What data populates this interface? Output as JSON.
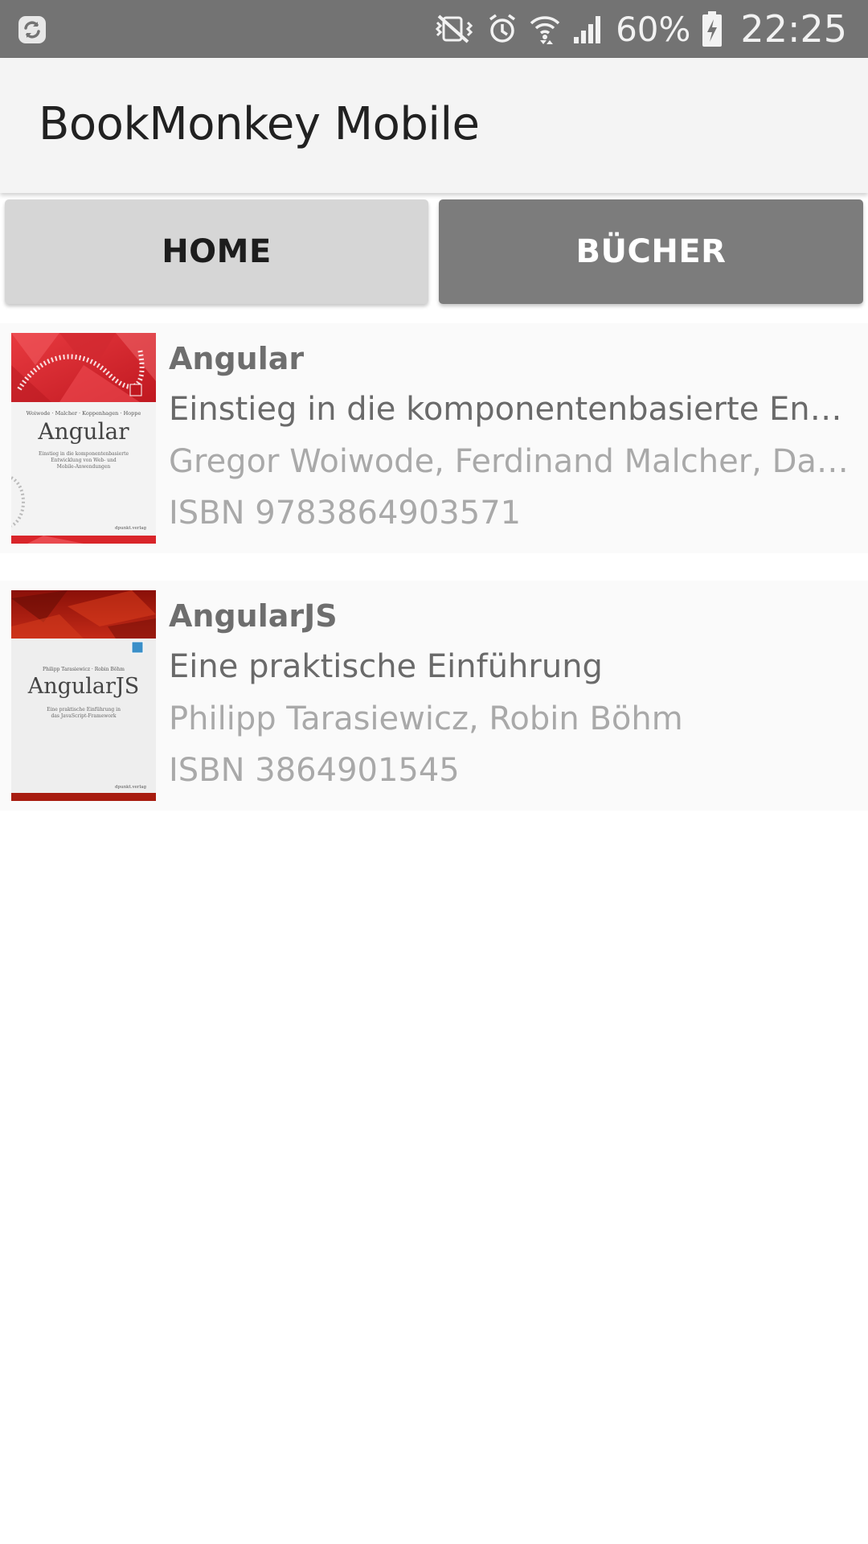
{
  "status_bar": {
    "icons": [
      "sync-icon",
      "mute-vibrate-icon",
      "alarm-icon",
      "wifi-icon",
      "signal-icon",
      "battery-charging-icon"
    ],
    "battery": "60%",
    "time": "22:25"
  },
  "app_bar": {
    "title": "BookMonkey Mobile"
  },
  "nav": {
    "home_label": "HOME",
    "books_label": "BÜCHER",
    "active": "books"
  },
  "books": [
    {
      "title": "Angular",
      "subtitle": "Einstieg in die komponentenbasierte Entwicklung von Web- und Mobile-Anwendungen",
      "authors": "Gregor Woiwode, Ferdinand Malcher, Danny Koppenhagen, Johannes Hoppe",
      "isbn": "ISBN 9783864903571",
      "cover": {
        "title": "Angular",
        "authors": "Woiwode · Malcher · Koppenhagen · Hoppe",
        "subtitle_line1": "Einstieg in die komponentenbasierte",
        "subtitle_line2": "Entwicklung von Web- und",
        "subtitle_line3": "Mobile-Anwendungen",
        "publisher": "dpunkt.verlag",
        "accent": "#d9252a"
      }
    },
    {
      "title": "AngularJS",
      "subtitle": "Eine praktische Einführung",
      "authors": "Philipp Tarasiewicz, Robin Böhm",
      "isbn": "ISBN 3864901545",
      "cover": {
        "title": "AngularJS",
        "authors": "Philipp Tarasiewicz · Robin Böhm",
        "subtitle_line1": "Eine praktische Einführung in",
        "subtitle_line2": "das JavaScript-Framework",
        "publisher": "dpunkt.verlag",
        "accent": "#a81c10"
      }
    }
  ],
  "colors": {
    "status_bar": "#737373",
    "app_bar": "#f4f4f4",
    "nav_inactive": "#d6d6d6",
    "nav_active": "#7c7c7c",
    "list_item": "#fafafa"
  }
}
